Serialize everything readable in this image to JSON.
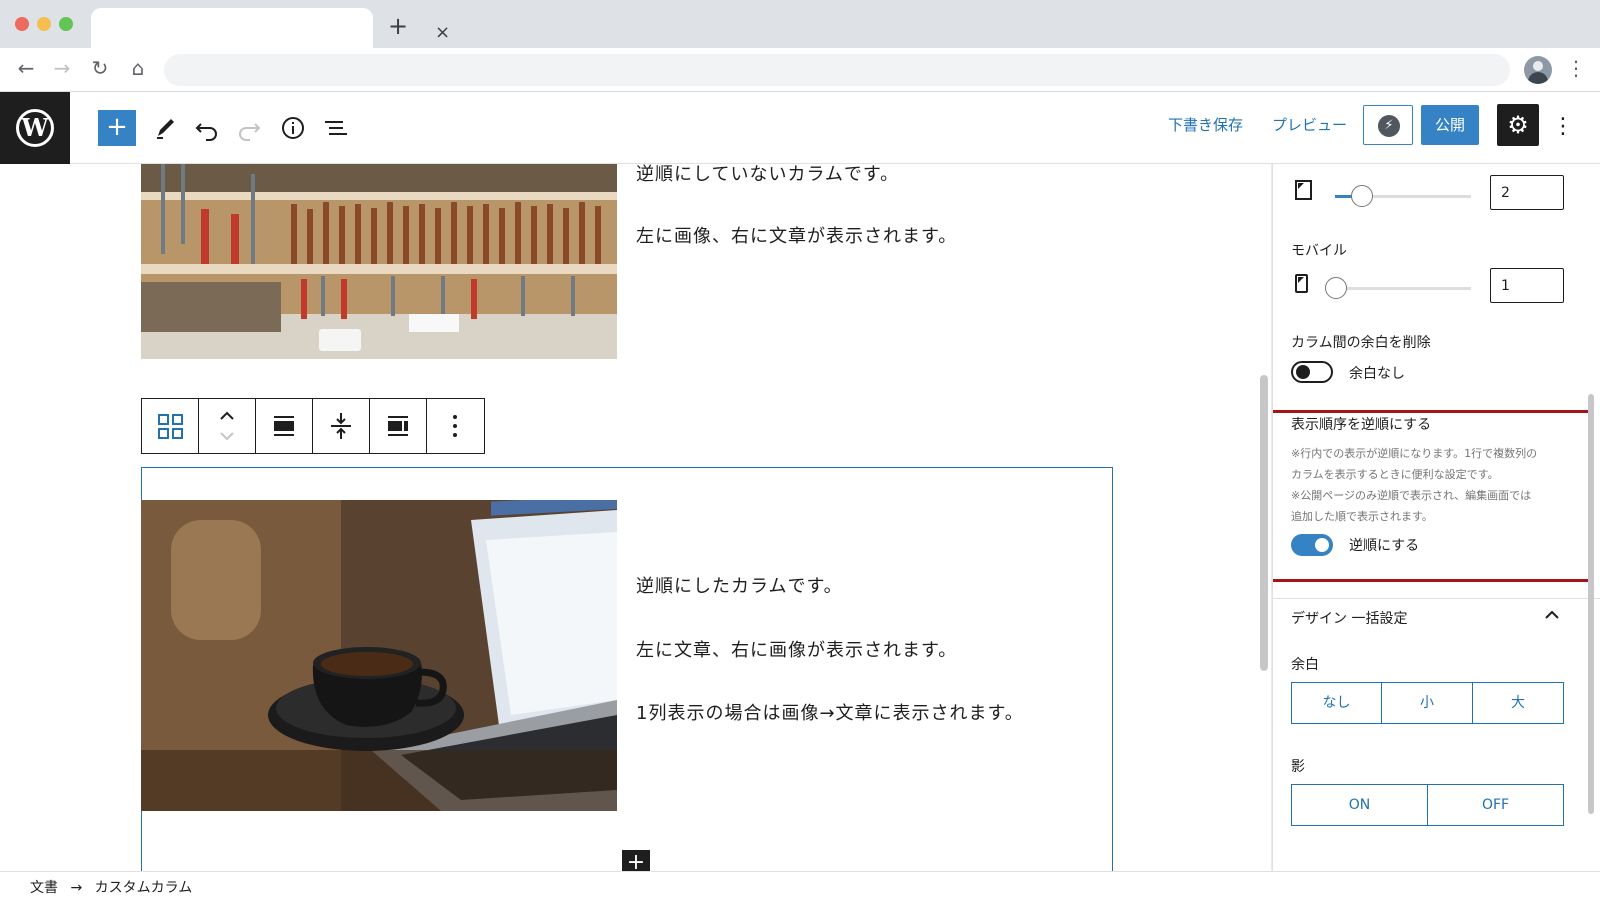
{
  "browser": {
    "tab_close": "×",
    "new_tab": "+",
    "nav": {
      "back": "←",
      "forward": "→",
      "reload": "↻",
      "home": "⌂"
    },
    "menu": "⋮",
    "traffic_colors": [
      "#ed6a5e",
      "#f5bf4f",
      "#61c554"
    ]
  },
  "toolbar": {
    "logo": "W",
    "inserter": "+",
    "save_draft": "下書き保存",
    "preview": "プレビュー",
    "bolt": "⚡",
    "publish": "公開",
    "settings": "⚙",
    "more": "⋮",
    "accent": "#3582c4"
  },
  "canvas": {
    "block1": {
      "line1": "逆順にしていないカラムです。",
      "line2": "左に画像、右に文章が表示されます。"
    },
    "block2": {
      "line1": "逆順にしたカラムです。",
      "line2": "左に文章、右に画像が表示されます。",
      "line3": "1列表示の場合は画像→文章に表示されます。"
    },
    "appender": "+"
  },
  "sidebar": {
    "tablet_value": "2",
    "mobile_label": "モバイル",
    "mobile_value": "1",
    "gap_label": "カラム間の余白を削除",
    "gap_toggle_label": "余白なし",
    "gap_toggle_on": false,
    "reverse_title": "表示順序を逆順にする",
    "reverse_notes": [
      "※行内での表示が逆順になります。1行で複数列の",
      "カラムを表示するときに便利な設定です。",
      "※公開ページのみ逆順で表示され、編集画面では",
      "追加した順で表示されます。"
    ],
    "reverse_toggle_label": "逆順にする",
    "reverse_toggle_on": true,
    "design_title": "デザイン 一括設定",
    "margin_label": "余白",
    "margin_options": [
      "なし",
      "小",
      "大"
    ],
    "shadow_label": "影",
    "shadow_options": [
      "ON",
      "OFF"
    ],
    "highlight_color": "#a4151b"
  },
  "footer": {
    "crumb_root": "文書",
    "crumb_arrow": "→",
    "crumb_current": "カスタムカラム"
  }
}
